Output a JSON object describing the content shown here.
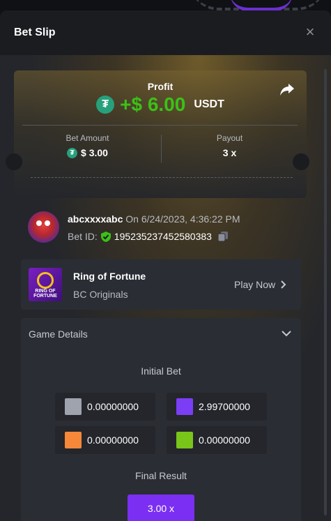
{
  "modal": {
    "title": "Bet Slip"
  },
  "profit": {
    "label": "Profit",
    "value": "+$ 6.00",
    "currency": "USDT",
    "color": "#3bc117"
  },
  "bet": {
    "bet_amount_label": "Bet Amount",
    "bet_amount_value": "$ 3.00",
    "payout_label": "Payout",
    "payout_value": "3 x"
  },
  "user": {
    "name": "abcxxxxabc",
    "time_prefix": "On 6/24/2023, 4:36:22 PM",
    "bet_id_label": "Bet ID:",
    "bet_id": "195235237452580383"
  },
  "game": {
    "name": "Ring of Fortune",
    "provider": "BC Originals",
    "play_label": "Play Now",
    "thumb_text": "RING OF FORTUNE"
  },
  "details": {
    "header": "Game Details",
    "initial_bet_label": "Initial Bet",
    "cells": [
      {
        "color": "#9ea3ad",
        "value": "0.00000000"
      },
      {
        "color": "#7b3ef5",
        "value": "2.99700000"
      },
      {
        "color": "#f7883a",
        "value": "0.00000000"
      },
      {
        "color": "#7ac51a",
        "value": "0.00000000"
      }
    ],
    "final_label": "Final Result",
    "final_value": "3.00 x",
    "final_color": "#7a2ff2"
  }
}
